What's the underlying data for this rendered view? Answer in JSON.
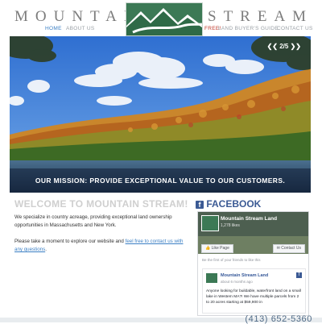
{
  "header": {
    "left_word": "MOUNTAIN",
    "right_word": "STREAM"
  },
  "nav": {
    "home": "HOME",
    "about": "ABOUT US",
    "free": "FREE!",
    "guide": "LAND BUYER'S GUIDE",
    "contact": "CONTACT US"
  },
  "hero": {
    "slide_indicator": "2/5",
    "prev_icon": "prev-arrow-icon",
    "next_icon": "next-arrow-icon",
    "mission": "OUR MISSION: PROVIDE EXCEPTIONAL VALUE TO OUR CUSTOMERS."
  },
  "welcome": {
    "title": "WELCOME TO MOUNTAIN STREAM!",
    "para1": "We specialize in country acreage, providing exceptional land ownership opportunities in Massachusetts and New York.",
    "para2_prefix": "Please take a moment to explore our website and ",
    "para2_link": "feel free to contact us with any questions",
    "para2_suffix": "."
  },
  "facebook": {
    "title": "FACEBOOK",
    "page_name": "Mountain Stream Land",
    "likes": "1,278 likes",
    "like_button": "Like Page",
    "contact_button": "Contact Us",
    "friends_prompt": "Be the first of your friends to like this",
    "post_name": "Mountain Stream Land",
    "post_time": "about 6 months ago",
    "post_text": "Anyone looking for buildable, waterfront land on a small lake in Western MA?! We have multiple parcels from 2 to 20 acres starting at $59,900 in"
  },
  "footer": {
    "phone": "(413) 652-5360"
  }
}
